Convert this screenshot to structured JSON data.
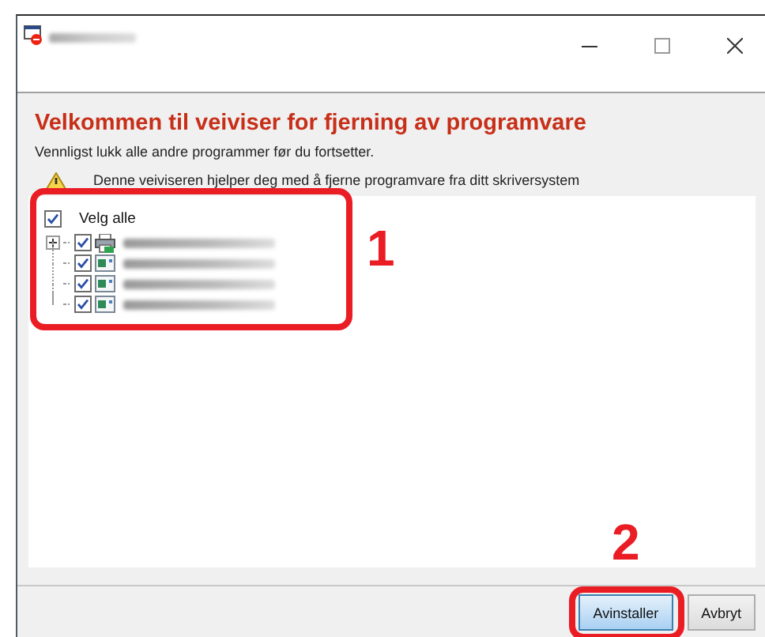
{
  "header": {
    "title": "Velkommen til veiviser for fjerning av programvare",
    "subtitle": "Vennligst lukk alle andre programmer før du fortsetter.",
    "notice": "Denne veiviseren hjelper deg med å fjerne programvare fra ditt skriversystem"
  },
  "tree": {
    "annotation": "1",
    "select_all": {
      "label": "Velg alle",
      "checked": true
    },
    "items": [
      {
        "kind": "printer",
        "checked": true,
        "expanded": false
      },
      {
        "kind": "app",
        "checked": true
      },
      {
        "kind": "app",
        "checked": true
      },
      {
        "kind": "app",
        "checked": true
      }
    ]
  },
  "buttons": [
    {
      "label": "Avinstaller",
      "focused": true,
      "annotation": "2"
    },
    {
      "label": "Avbryt",
      "focused": false
    }
  ]
}
